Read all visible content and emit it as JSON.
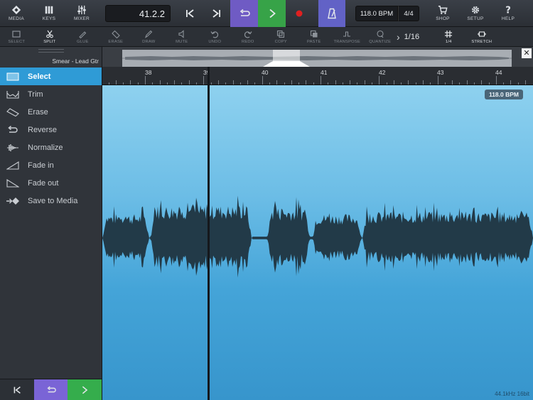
{
  "toolbar": {
    "media": "MEDIA",
    "keys": "KEYS",
    "mixer": "MIXER",
    "position": "41.2.2",
    "bpm": "118.0 BPM",
    "time_signature": "4/4",
    "shop": "SHOP",
    "setup": "SETUP",
    "help": "HELP"
  },
  "editbar": {
    "select": "SELECT",
    "split": "SPLIT",
    "glue": "GLUE",
    "erase": "ERASE",
    "draw": "DRAW",
    "mute": "MUTE",
    "undo": "UNDO",
    "redo": "REDO",
    "copy": "COPY",
    "paste": "PASTE",
    "transpose": "TRANSPOSE",
    "quantize": "QUANTIZE",
    "quantize_value": "1/16",
    "grid": "1/4",
    "stretch": "STRETCH"
  },
  "track": {
    "name": "Smear - Lead Gtr"
  },
  "overview": {
    "close": "✕"
  },
  "ruler": {
    "bars": [
      "38",
      "39",
      "40",
      "41",
      "42",
      "43",
      "44"
    ]
  },
  "sidebar": {
    "items": [
      {
        "label": "Select",
        "icon": "select-icon",
        "active": true
      },
      {
        "label": "Trim",
        "icon": "trim-icon"
      },
      {
        "label": "Erase",
        "icon": "erase-icon"
      },
      {
        "label": "Reverse",
        "icon": "reverse-icon"
      },
      {
        "label": "Normalize",
        "icon": "normalize-icon"
      },
      {
        "label": "Fade in",
        "icon": "fade-in-icon"
      },
      {
        "label": "Fade out",
        "icon": "fade-out-icon"
      },
      {
        "label": "Save to Media",
        "icon": "save-to-media-icon"
      }
    ]
  },
  "editor": {
    "bpm_badge": "118.0 BPM",
    "audio_info": "44.1kHz 16bit"
  },
  "colors": {
    "loop": "#6f5bc4",
    "play": "#37a348",
    "metronome": "#6262c6",
    "record": "#e02020",
    "selection": "#2f9bd6",
    "waveform": "#223a48"
  }
}
